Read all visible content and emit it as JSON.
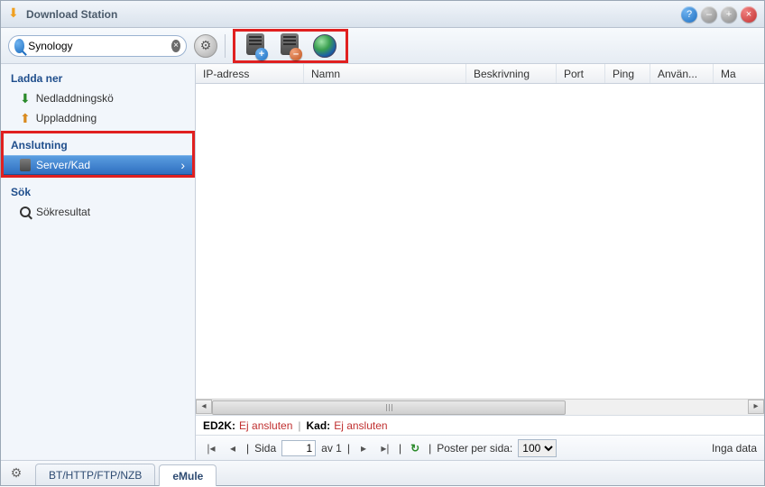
{
  "window": {
    "title": "Download Station"
  },
  "search": {
    "value": "Synology"
  },
  "toolbar": {
    "gear": "gear",
    "add_server": "add-server",
    "remove_server": "remove-server",
    "globe": "connect-kad"
  },
  "sidebar": {
    "download": {
      "header": "Ladda ner",
      "queue": "Nedladdningskö",
      "upload": "Uppladdning"
    },
    "connection": {
      "header": "Anslutning",
      "serverkad": "Server/Kad"
    },
    "search": {
      "header": "Sök",
      "results": "Sökresultat"
    }
  },
  "columns": {
    "ip": "IP-adress",
    "name": "Namn",
    "desc": "Beskrivning",
    "port": "Port",
    "ping": "Ping",
    "users": "Använ...",
    "max": "Ma"
  },
  "status": {
    "ed2k_label": "ED2K:",
    "ed2k_value": "Ej ansluten",
    "kad_label": "Kad:",
    "kad_value": "Ej ansluten"
  },
  "pager": {
    "page_label": "Sida",
    "page_value": "1",
    "of_label": "av 1",
    "perpage_label": "Poster per sida:",
    "perpage_value": "100",
    "nodata": "Inga data"
  },
  "tabs": {
    "bt": "BT/HTTP/FTP/NZB",
    "emule": "eMule"
  }
}
